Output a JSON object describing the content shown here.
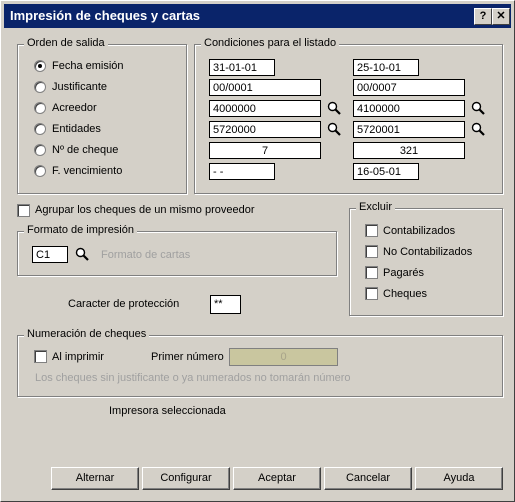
{
  "window": {
    "title": "Impresión de cheques y cartas",
    "help_btn": "?",
    "close_btn": "✕"
  },
  "orden": {
    "legend": "Orden de salida",
    "options": [
      "Fecha emisión",
      "Justificante",
      "Acreedor",
      "Entidades",
      "Nº de cheque",
      "F. vencimiento"
    ],
    "selected": "Fecha emisión"
  },
  "condiciones": {
    "legend": "Condiciones para el listado",
    "rows": [
      {
        "from": "31-01-01",
        "to": "25-10-01"
      },
      {
        "from": "00/0001",
        "to": "00/0007"
      },
      {
        "from": "4000000",
        "to": "4100000"
      },
      {
        "from": "5720000",
        "to": "5720001"
      },
      {
        "from": "7",
        "to": "321"
      },
      {
        "from": "- -",
        "to": "16-05-01"
      }
    ]
  },
  "agrupar": {
    "label": "Agrupar los cheques de un mismo proveedor",
    "checked": false
  },
  "formato": {
    "legend": "Formato de impresión",
    "code": "C1",
    "desc": "Formato de cartas"
  },
  "excluir": {
    "legend": "Excluir",
    "options": [
      "Contabilizados",
      "No Contabilizados",
      "Pagarés",
      "Cheques"
    ]
  },
  "caracter": {
    "label": "Caracter de protección",
    "value": "**"
  },
  "numeracion": {
    "legend": "Numeración de cheques",
    "al_imprimir": "Al imprimir",
    "primer_label": "Primer número",
    "primer_value": "0",
    "note": "Los cheques sin justificante o ya numerados no tomarán número"
  },
  "impresora": {
    "label": "Impresora seleccionada"
  },
  "buttons": {
    "alternar": "Alternar",
    "configurar": "Configurar",
    "aceptar": "Aceptar",
    "cancelar": "Cancelar",
    "ayuda": "Ayuda"
  }
}
